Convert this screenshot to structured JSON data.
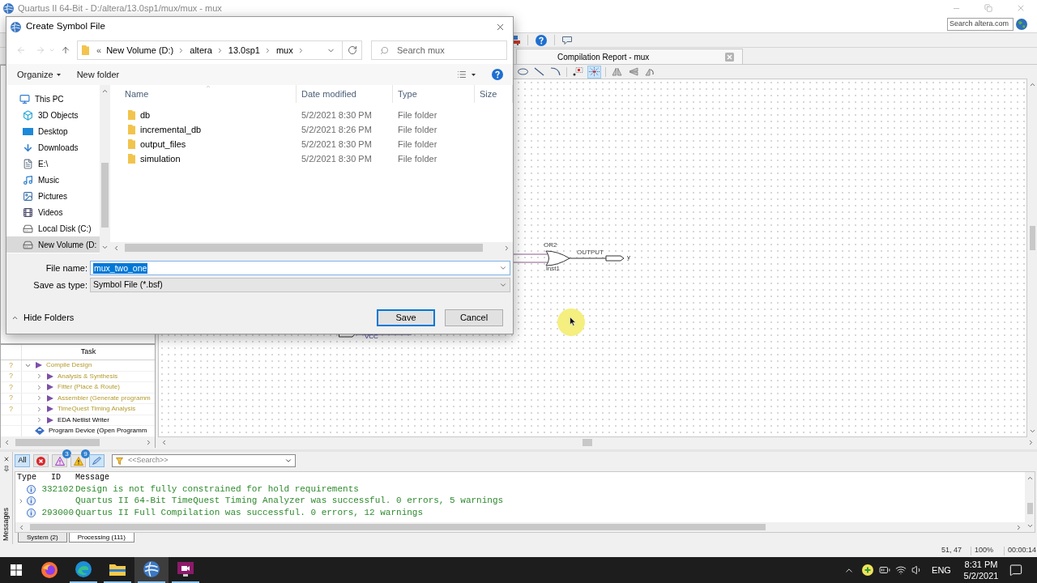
{
  "window": {
    "title": "Quartus II 64-Bit - D:/altera/13.0sp1/mux/mux - mux"
  },
  "help_search": {
    "placeholder": "Search altera.com"
  },
  "document_tabs": [
    {
      "label": "Compilation Report - mux"
    }
  ],
  "schematic_tools": [
    {
      "kind": "ellipse",
      "selected": false
    },
    {
      "kind": "line",
      "selected": false
    },
    {
      "kind": "arc",
      "selected": false
    },
    {
      "kind": "connector",
      "selected": false
    },
    {
      "kind": "rubberband",
      "selected": true
    },
    {
      "kind": "flip_h",
      "selected": false
    },
    {
      "kind": "flip_v",
      "selected": false
    },
    {
      "kind": "rotate",
      "selected": false
    }
  ],
  "schematic": {
    "gate_type": "OR2",
    "gate_instance": "inst1",
    "pin_type": "OUTPUT",
    "pin_name": "y",
    "supply_label": "VCC"
  },
  "task_panel": {
    "header": "Task",
    "tasks": [
      {
        "label": "Compile Design",
        "kind": "compile",
        "status": "?",
        "outdated": true,
        "expanded": true,
        "children": [
          {
            "label": "Analysis & Synthesis",
            "kind": "compile",
            "status": "?",
            "outdated": true,
            "expanded": false
          },
          {
            "label": "Fitter (Place & Route)",
            "kind": "compile",
            "status": "?",
            "outdated": true,
            "expanded": false
          },
          {
            "label": "Assembler (Generate programm",
            "kind": "compile",
            "status": "?",
            "outdated": true,
            "expanded": false
          },
          {
            "label": "TimeQuest Timing Analysis",
            "kind": "compile",
            "status": "?",
            "outdated": true,
            "expanded": false
          },
          {
            "label": "EDA Netlist Writer",
            "kind": "compile",
            "outdated": false,
            "expanded": false
          }
        ]
      },
      {
        "label": "Program Device (Open Programm",
        "kind": "device",
        "outdated": false
      }
    ]
  },
  "messages": {
    "side_label": "Messages",
    "filters": [
      {
        "kind": "all",
        "label": "All",
        "selected": true
      },
      {
        "kind": "error",
        "selected": false
      },
      {
        "kind": "critical",
        "badge": "3",
        "selected": false
      },
      {
        "kind": "warning",
        "badge": "9",
        "selected": false
      },
      {
        "kind": "suppressed",
        "selected": true
      }
    ],
    "search": {
      "placeholder": "<<Search>>"
    },
    "columns": [
      "Type",
      "ID",
      "Message"
    ],
    "rows": [
      {
        "kind": "info",
        "id": "332102",
        "message": "Design is not fully constrained for hold requirements"
      },
      {
        "kind": "info",
        "expanded": false,
        "message": "Quartus II 64-Bit TimeQuest Timing Analyzer was successful. 0 errors, 5 warnings"
      },
      {
        "kind": "info",
        "id": "293000",
        "message": "Quartus II Full Compilation was successful. 0 errors, 12 warnings"
      }
    ],
    "tabs": [
      {
        "label": "System (2)",
        "selected": false
      },
      {
        "label": "Processing (111)",
        "selected": true
      }
    ]
  },
  "status_bar": {
    "position": "51, 47",
    "zoom": "100%",
    "elapsed": "00:00:14"
  },
  "taskbar": {
    "apps": [
      {
        "kind": "firefox",
        "running": false,
        "active": false
      },
      {
        "kind": "edge",
        "running": true,
        "active": false
      },
      {
        "kind": "explorer",
        "running": true,
        "active": false
      },
      {
        "kind": "quartus",
        "running": true,
        "active": true
      },
      {
        "kind": "recorder",
        "running": true,
        "active": false
      }
    ],
    "language": "ENG",
    "time": "8:31 PM",
    "date": "5/2/2021"
  },
  "dialog": {
    "title": "Create Symbol File",
    "address": {
      "overflow": "«",
      "segments": [
        "New Volume (D:)",
        "altera",
        "13.0sp1",
        "mux"
      ]
    },
    "search": {
      "placeholder": "Search mux"
    },
    "commands": [
      {
        "label": "Organize",
        "menu": true
      },
      {
        "label": "New folder",
        "menu": false
      }
    ],
    "nav_tree": [
      {
        "label": "This PC",
        "kind": "pc",
        "selected": false,
        "children": [
          {
            "label": "3D Objects",
            "kind": "objects",
            "selected": false
          },
          {
            "label": "Desktop",
            "kind": "desktop",
            "selected": false
          },
          {
            "label": "Downloads",
            "kind": "downloads",
            "selected": false
          },
          {
            "label": "E:\\",
            "kind": "removable",
            "selected": false
          },
          {
            "label": "Music",
            "kind": "music",
            "selected": false
          },
          {
            "label": "Pictures",
            "kind": "pictures",
            "selected": false
          },
          {
            "label": "Videos",
            "kind": "videos",
            "selected": false
          },
          {
            "label": "Local Disk (C:)",
            "kind": "disk",
            "selected": false
          },
          {
            "label": "New Volume (D:",
            "kind": "disk",
            "selected": true
          }
        ]
      }
    ],
    "columns": [
      "Name",
      "Date modified",
      "Type",
      "Size"
    ],
    "files": [
      {
        "name": "db",
        "modified": "5/2/2021 8:30 PM",
        "type": "File folder"
      },
      {
        "name": "incremental_db",
        "modified": "5/2/2021 8:26 PM",
        "type": "File folder"
      },
      {
        "name": "output_files",
        "modified": "5/2/2021 8:30 PM",
        "type": "File folder"
      },
      {
        "name": "simulation",
        "modified": "5/2/2021 8:30 PM",
        "type": "File folder"
      }
    ],
    "file_name": {
      "label": "File name:",
      "value": "mux_two_one",
      "value_selected": true
    },
    "save_as_type": {
      "label": "Save as type:",
      "value": "Symbol File (*.bsf)"
    },
    "hide_folders": "Hide Folders",
    "buttons": [
      {
        "label": "Save",
        "default": true
      },
      {
        "label": "Cancel",
        "default": false
      }
    ]
  }
}
